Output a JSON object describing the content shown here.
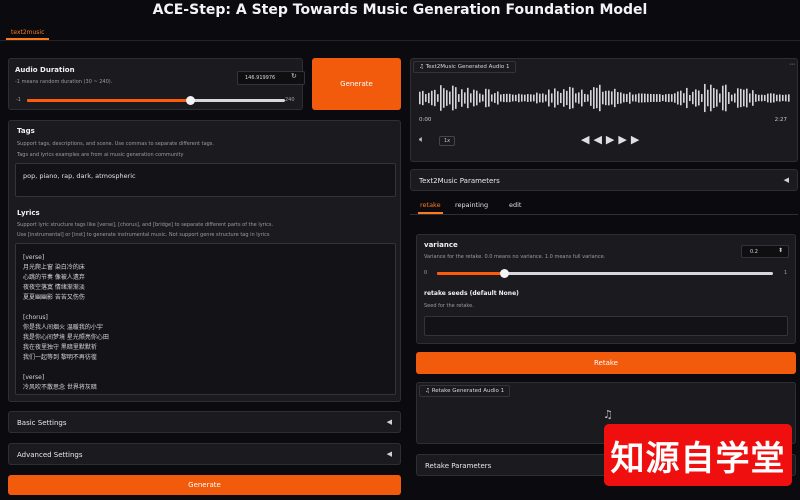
{
  "app": {
    "title": "ACE-Step: A Step Towards Music Generation Foundation Model",
    "top_tab": "text2music"
  },
  "duration": {
    "label": "Audio Duration",
    "info": "-1 means random duration (30 ~ 240).",
    "value": "146.919976",
    "min_label": "-1",
    "max_label": "240",
    "fill_percent": 63,
    "reset_icon": "reset-icon"
  },
  "generate_top": "Generate",
  "generate_bottom": "Generate",
  "tags": {
    "label": "Tags",
    "info_1": "Support tags, descriptions, and scene. Use commas to separate different tags.",
    "info_2": "Tags and lyrics examples are from ai music generation community",
    "value": "pop, piano, rap, dark, atmospheric"
  },
  "lyrics": {
    "label": "Lyrics",
    "info_1": "Support lyric structure tags like [verse], [chorus], and [bridge] to separate different parts of the lyrics.",
    "info_2": "Use [instrumental] or [inst] to generate instrumental music. Not support genre structure tag in lyrics",
    "lines": [
      "[verse]",
      "月光爬上窗 染白冷的床",
      "心跳的节奏 像被人遗弃",
      "夜夜空落寞 情绪渐渐淡",
      "夏夏幽幽影 苦苦又伤伤",
      "",
      "[chorus]",
      "你是我人间烟火 温暖我的小宇",
      "我是你心间梦境 星光照亮你心田",
      "我在夜里独守 黑暗里默默祈",
      "我们一起等到 黎明不再彷徨",
      "",
      "[verse]",
      "冷风吹不散思念 世界将灰暗"
    ]
  },
  "basic_settings": "Basic Settings",
  "advanced_settings": "Advanced Settings",
  "player": {
    "tag": "Text2Music Generated Audio 1",
    "time_start": "0:00",
    "time_end": "2:27",
    "speed": "1x",
    "volume_icon": "volume-icon",
    "rewind_icon": "rewind-icon",
    "play_icon": "play-icon",
    "forward_icon": "fast-forward-icon"
  },
  "t2m_params": "Text2Music Parameters",
  "subtabs": {
    "retake": "retake",
    "repainting": "repainting",
    "edit": "edit"
  },
  "variance": {
    "label": "variance",
    "info": "Variance for the retake. 0.0 means no variance. 1.0 means full variance.",
    "value": "0.2",
    "min_label": "0",
    "max_label": "1",
    "fill_percent": 20,
    "seeds_label": "retake seeds (default None)",
    "seeds_placeholder": "Seed for the retake."
  },
  "retake_button": "Retake",
  "retake_audio": {
    "tag": "Retake Generated Audio 1",
    "music_icon": "music-note-icon"
  },
  "retake_params": "Retake Parameters",
  "watermark": "知源自学堂"
}
